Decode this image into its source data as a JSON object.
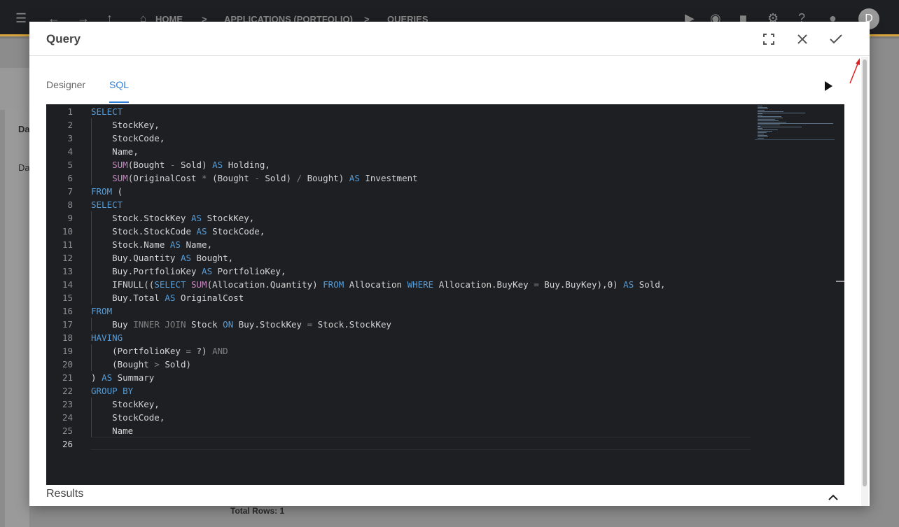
{
  "background": {
    "breadcrumb": [
      "HOME",
      "APPLICATIONS (PORTFOLIO)",
      "QUERIES"
    ],
    "avatar_letter": "D",
    "side_text_1": "Da",
    "side_text_2": "Da",
    "total_rows": "Total Rows: 1"
  },
  "dialog": {
    "title": "Query",
    "tabs": [
      {
        "label": "Designer",
        "active": false
      },
      {
        "label": "SQL",
        "active": true
      }
    ],
    "results_label": "Results"
  },
  "editor": {
    "current_line": 26,
    "lines": [
      [
        [
          "kw",
          "SELECT"
        ]
      ],
      [
        [
          "t",
          "    StockKey,"
        ]
      ],
      [
        [
          "t",
          "    StockCode,"
        ]
      ],
      [
        [
          "t",
          "    Name,"
        ]
      ],
      [
        [
          "t",
          "    "
        ],
        [
          "fn",
          "SUM"
        ],
        [
          "t",
          "(Bought "
        ],
        [
          "op",
          "-"
        ],
        [
          "t",
          " Sold) "
        ],
        [
          "kw",
          "AS"
        ],
        [
          "t",
          " Holding,"
        ]
      ],
      [
        [
          "t",
          "    "
        ],
        [
          "fn",
          "SUM"
        ],
        [
          "t",
          "(OriginalCost "
        ],
        [
          "op",
          "*"
        ],
        [
          "t",
          " (Bought "
        ],
        [
          "op",
          "-"
        ],
        [
          "t",
          " Sold) "
        ],
        [
          "op",
          "/"
        ],
        [
          "t",
          " Bought) "
        ],
        [
          "kw",
          "AS"
        ],
        [
          "t",
          " Investment"
        ]
      ],
      [
        [
          "kw",
          "FROM"
        ],
        [
          "t",
          " ("
        ]
      ],
      [
        [
          "kw",
          "SELECT"
        ]
      ],
      [
        [
          "t",
          "    Stock.StockKey "
        ],
        [
          "kw",
          "AS"
        ],
        [
          "t",
          " StockKey,"
        ]
      ],
      [
        [
          "t",
          "    Stock.StockCode "
        ],
        [
          "kw",
          "AS"
        ],
        [
          "t",
          " StockCode,"
        ]
      ],
      [
        [
          "t",
          "    Stock.Name "
        ],
        [
          "kw",
          "AS"
        ],
        [
          "t",
          " Name,"
        ]
      ],
      [
        [
          "t",
          "    Buy.Quantity "
        ],
        [
          "kw",
          "AS"
        ],
        [
          "t",
          " Bought,"
        ]
      ],
      [
        [
          "t",
          "    Buy.PortfolioKey "
        ],
        [
          "kw",
          "AS"
        ],
        [
          "t",
          " PortfolioKey,"
        ]
      ],
      [
        [
          "t",
          "    IFNULL(("
        ],
        [
          "kw",
          "SELECT"
        ],
        [
          "t",
          " "
        ],
        [
          "fn",
          "SUM"
        ],
        [
          "t",
          "(Allocation.Quantity) "
        ],
        [
          "kw",
          "FROM"
        ],
        [
          "t",
          " Allocation "
        ],
        [
          "kw",
          "WHERE"
        ],
        [
          "t",
          " Allocation.BuyKey "
        ],
        [
          "op",
          "="
        ],
        [
          "t",
          " Buy.BuyKey),0) "
        ],
        [
          "kw",
          "AS"
        ],
        [
          "t",
          " Sold,"
        ]
      ],
      [
        [
          "t",
          "    Buy.Total "
        ],
        [
          "kw",
          "AS"
        ],
        [
          "t",
          " OriginalCost"
        ]
      ],
      [
        [
          "kw",
          "FROM"
        ]
      ],
      [
        [
          "t",
          "    Buy "
        ],
        [
          "op",
          "INNER JOIN"
        ],
        [
          "t",
          " Stock "
        ],
        [
          "kw",
          "ON"
        ],
        [
          "t",
          " Buy.StockKey "
        ],
        [
          "op",
          "="
        ],
        [
          "t",
          " Stock.StockKey"
        ]
      ],
      [
        [
          "kw",
          "HAVING"
        ]
      ],
      [
        [
          "t",
          "    (PortfolioKey "
        ],
        [
          "op",
          "="
        ],
        [
          "t",
          " ?) "
        ],
        [
          "op",
          "AND"
        ]
      ],
      [
        [
          "t",
          "    (Bought "
        ],
        [
          "op",
          ">"
        ],
        [
          "t",
          " Sold)"
        ]
      ],
      [
        [
          "t",
          ") "
        ],
        [
          "kw",
          "AS"
        ],
        [
          "t",
          " Summary"
        ]
      ],
      [
        [
          "kw",
          "GROUP BY"
        ]
      ],
      [
        [
          "t",
          "    StockKey,"
        ]
      ],
      [
        [
          "t",
          "    StockCode,"
        ]
      ],
      [
        [
          "t",
          "    Name"
        ]
      ],
      [
        [
          "t",
          ""
        ]
      ]
    ]
  },
  "icons": {
    "fullscreen": "fullscreen-icon",
    "close": "close-icon",
    "confirm": "check-icon",
    "run": "play-icon",
    "collapse": "chevron-up-icon"
  },
  "colors": {
    "accent": "#2f7fd6",
    "editor_bg": "#1e1f23",
    "keyword": "#569cd6",
    "function": "#c586c0",
    "annotation_arrow": "#e02020"
  }
}
